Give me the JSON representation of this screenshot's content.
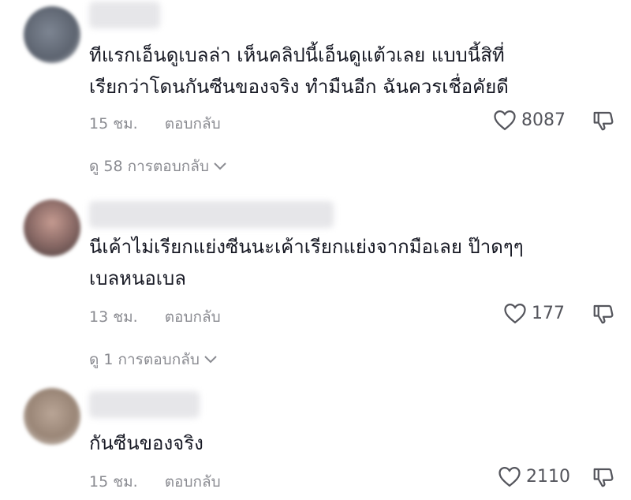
{
  "comments": [
    {
      "text": "ทีแรกเอ็นดูเบลล่า เห็นคลิปนี้เอ็นดูแต้วเลย แบบนี้สิที่\nเรียกว่าโดนกันซีนของจริง ทำมืนอีก ฉันควรเชื่อคัยดี",
      "time": "15 ชม.",
      "reply_label": "ตอบกลับ",
      "likes": "8087",
      "view_replies": "ดู 58 การตอบกลับ",
      "avatar_color": "#6b7380"
    },
    {
      "text": "นีเค้าไม่เรียกแย่งซีนนะเค้าเรียกแย่งจากมือเลย ป๊าดๆๆ\nเบลหนอเบล",
      "time": "13 ชม.",
      "reply_label": "ตอบกลับ",
      "likes": "177",
      "view_replies": "ดู 1 การตอบกลับ",
      "avatar_color": "#8a6a66"
    },
    {
      "text": "กันซีนของจริง",
      "time": "15 ชม.",
      "reply_label": "ตอบกลับ",
      "likes": "2110",
      "avatar_color": "#9a8677"
    }
  ]
}
